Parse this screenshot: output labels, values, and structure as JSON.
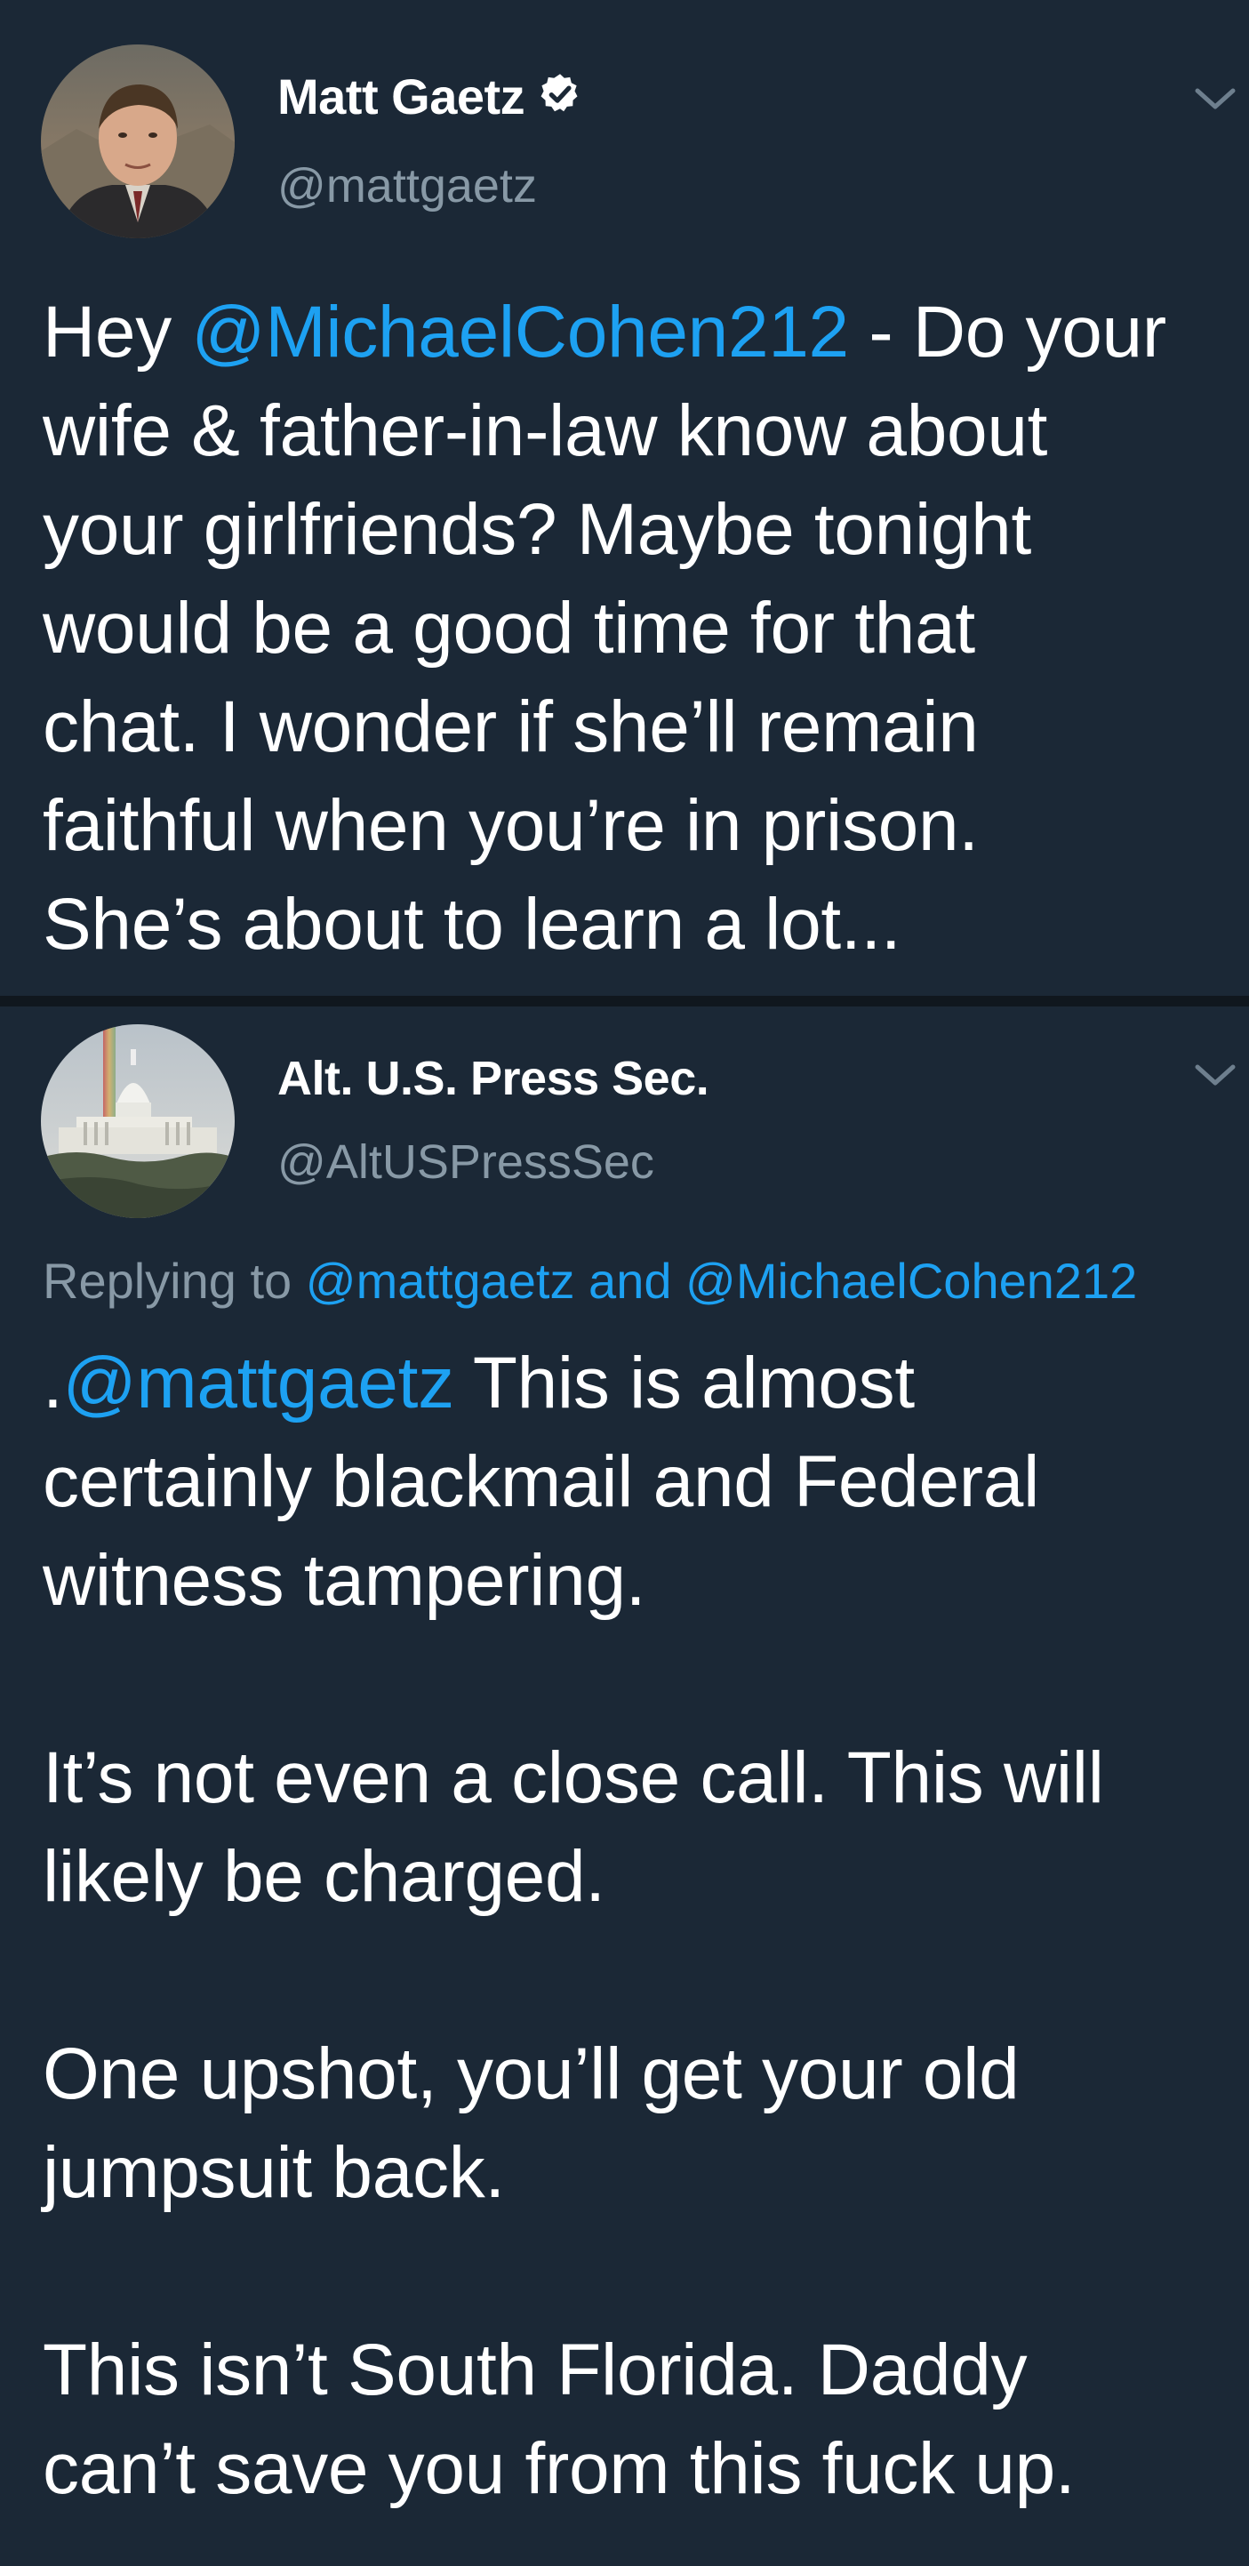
{
  "tweets": [
    {
      "display_name": "Matt Gaetz",
      "handle": "@mattgaetz",
      "verified": true,
      "avatar_icon": "portrait-avatar",
      "body": {
        "t1": "Hey ",
        "mention": "@MichaelCohen212",
        "t2": " - Do your\nwife & father-in-law know about\nyour girlfriends? Maybe tonight\nwould be a good time for that\nchat. I wonder if she’ll remain\nfaithful when you’re in prison.\nShe’s about to learn a lot..."
      }
    },
    {
      "display_name": "Alt. U.S. Press Sec.",
      "handle": "@AltUSPressSec",
      "verified": false,
      "avatar_icon": "capitol-building-avatar",
      "reply": {
        "prefix": "Replying to ",
        "mention1": "@mattgaetz",
        "joiner": " and ",
        "mention2": "@MichaelCohen212"
      },
      "body": {
        "t0": ".",
        "mention": "@mattgaetz",
        "t1": " This is almost\ncertainly blackmail and Federal\nwitness tampering.\n\nIt’s not even a close call. This will\nlikely be charged.\n\nOne upshot, you’ll get your old\njumpsuit back.\n\nThis isn’t South Florida. Daddy\ncan’t save you from this fuck up."
      }
    }
  ],
  "colors": {
    "background": "#1b2836",
    "divider": "#10171e",
    "text": "#ffffff",
    "secondary": "#8899a6",
    "link": "#1da1f2"
  }
}
